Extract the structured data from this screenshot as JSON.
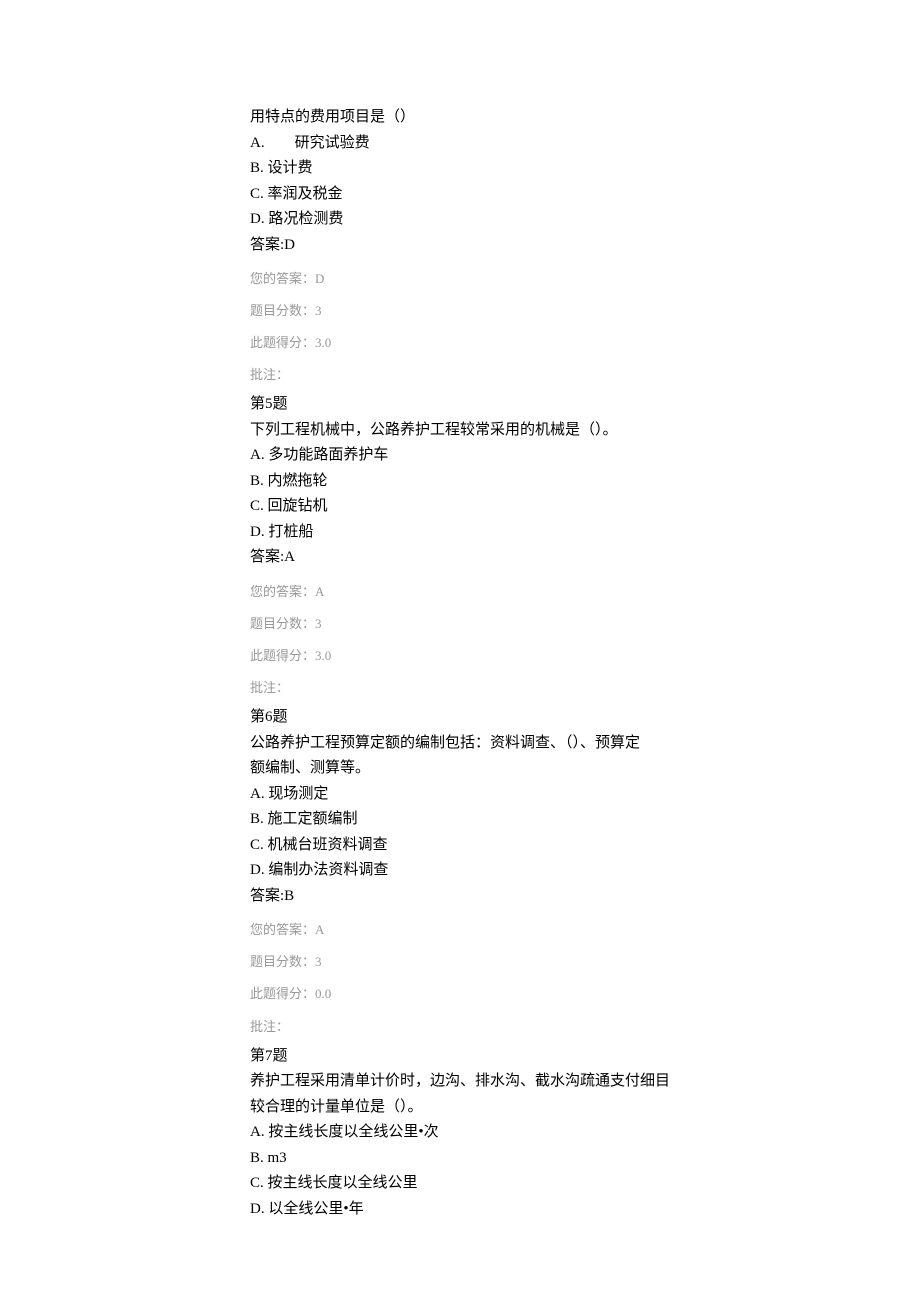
{
  "q4_partial": {
    "stem_tail": "用特点的费用项目是（）",
    "optA_label": "A.",
    "optA_indent_space": "　　",
    "optA_text": "研究试验费",
    "optB": "B. 设计费",
    "optC": "C. 率润及税金",
    "optD": "D. 路况检测费",
    "answer": "答案:D",
    "your_answer": "您的答案：D",
    "score_label": "题目分数：3",
    "got_score": "此题得分：3.0",
    "note": "批注："
  },
  "q5": {
    "title": "第5题",
    "stem": "下列工程机械中，公路养护工程较常采用的机械是（）。",
    "optA": "A. 多功能路面养护车",
    "optB": "B. 内燃拖轮",
    "optC": "C. 回旋钻机",
    "optD": "D. 打桩船",
    "answer": "答案:A",
    "your_answer": "您的答案：A",
    "score_label": "题目分数：3",
    "got_score": "此题得分：3.0",
    "note": "批注："
  },
  "q6": {
    "title": "第6题",
    "stem_l1": "公路养护工程预算定额的编制包括：资料调查、（）、预算定",
    "stem_l2": "额编制、测算等。",
    "optA": "A. 现场测定",
    "optB": "B. 施工定额编制",
    "optC": "C. 机械台班资料调查",
    "optD": "D. 编制办法资料调查",
    "answer": "答案:B",
    "your_answer": "您的答案：A",
    "score_label": "题目分数：3",
    "got_score": "此题得分：0.0",
    "note": "批注："
  },
  "q7": {
    "title": "第7题",
    "stem_l1": "养护工程采用清单计价时，边沟、排水沟、截水沟疏通支付细目",
    "stem_l2": "较合理的计量单位是（）。",
    "optA": "A. 按主线长度以全线公里•次",
    "optB": "B. m3",
    "optC": "C. 按主线长度以全线公里",
    "optD": "D. 以全线公里•年"
  }
}
